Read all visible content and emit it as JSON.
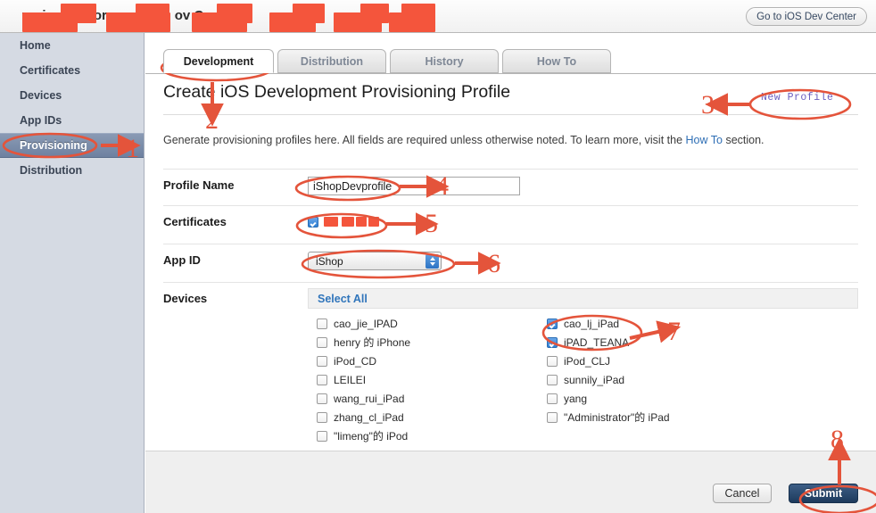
{
  "window": {
    "header_title_partial": "rovis   o Po    lorv   ons   & te   ov C",
    "dev_center_button": "Go to iOS Dev Center",
    "redaction_color": "#f4553c"
  },
  "sidebar": {
    "items": [
      {
        "label": "Home",
        "active": false
      },
      {
        "label": "Certificates",
        "active": false
      },
      {
        "label": "Devices",
        "active": false
      },
      {
        "label": "App IDs",
        "active": false
      },
      {
        "label": "Provisioning",
        "active": true
      },
      {
        "label": "Distribution",
        "active": false
      }
    ]
  },
  "tabs": [
    {
      "label": "Development",
      "active": true
    },
    {
      "label": "Distribution",
      "active": false
    },
    {
      "label": "History",
      "active": false
    },
    {
      "label": "How To",
      "active": false
    }
  ],
  "main": {
    "page_title": "Create iOS Development Provisioning Profile",
    "new_profile_label": "New Profile",
    "subtitle_before": "Generate provisioning profiles here. All fields are required unless otherwise noted. To learn more, visit the ",
    "subtitle_link": "How To",
    "subtitle_after": " section."
  },
  "form": {
    "profile_name": {
      "label": "Profile Name",
      "value": "iShopDevprofile",
      "placeholder": ""
    },
    "certificates": {
      "label": "Certificates",
      "checked": true,
      "name_redacted": true
    },
    "app_id": {
      "label": "App ID",
      "selected": "iShop",
      "options": [
        "iShop"
      ]
    },
    "devices": {
      "label": "Devices",
      "select_all_label": "Select All",
      "left_column": [
        {
          "label": "cao_jie_IPAD",
          "checked": false
        },
        {
          "label": "henry 的 iPhone",
          "checked": false
        },
        {
          "label": "iPod_CD",
          "checked": false
        },
        {
          "label": "LEILEI",
          "checked": false
        },
        {
          "label": "wang_rui_iPad",
          "checked": false
        },
        {
          "label": "zhang_cl_iPad",
          "checked": false
        },
        {
          "label": "\"limeng\"的 iPod",
          "checked": false
        }
      ],
      "right_column": [
        {
          "label": "cao_lj_iPad",
          "checked": true
        },
        {
          "label": "iPAD_TEANA",
          "checked": true
        },
        {
          "label": "iPod_CLJ",
          "checked": false
        },
        {
          "label": "sunnily_iPad",
          "checked": false
        },
        {
          "label": "yang",
          "checked": false
        },
        {
          "label": "\"Administrator\"的 iPad",
          "checked": false
        }
      ]
    }
  },
  "footer": {
    "cancel_label": "Cancel",
    "submit_label": "Submit"
  },
  "annotations": {
    "color": "#e4543b",
    "steps": [
      {
        "number": "1",
        "target": "sidebar-item-provisioning"
      },
      {
        "number": "2",
        "target": "tab-development"
      },
      {
        "number": "3",
        "target": "new-profile-label"
      },
      {
        "number": "4",
        "target": "profile-name-input"
      },
      {
        "number": "5",
        "target": "certificates-checkbox"
      },
      {
        "number": "6",
        "target": "app-id-select"
      },
      {
        "number": "7",
        "target": "devices-checked-group"
      },
      {
        "number": "8",
        "target": "submit-button"
      }
    ]
  }
}
